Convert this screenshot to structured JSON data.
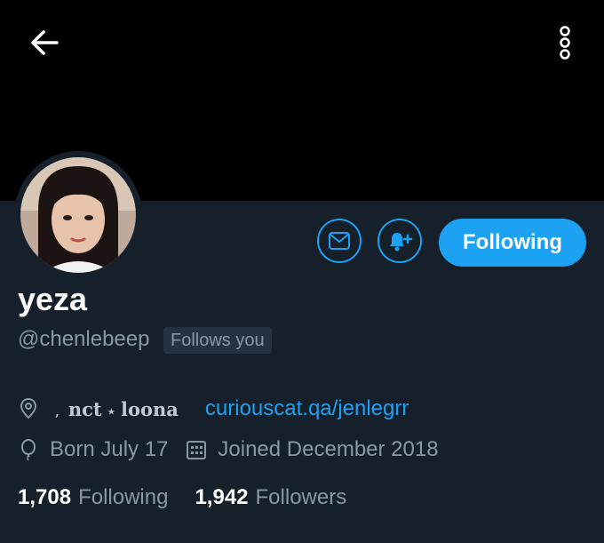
{
  "header": {
    "back_icon": "arrow-left-icon",
    "more_icon": "more-vertical-icon"
  },
  "profile": {
    "display_name": "yeza",
    "handle": "@chenlebeep",
    "follows_you_badge": "Follows you",
    "avatar_icon": "profile-avatar"
  },
  "actions": {
    "message_icon": "envelope-icon",
    "notify_icon": "bell-plus-icon",
    "following_label": "Following"
  },
  "details": {
    "location_part1": "nct",
    "location_separator": "⋆",
    "location_part2": "loona",
    "location_prefix": "‚",
    "website": "curiouscat.qa/jenlegrr",
    "birthday": "Born July 17",
    "joined": "Joined December 2018"
  },
  "stats": {
    "following_count": "1,708",
    "following_label": "Following",
    "followers_count": "1,942",
    "followers_label": "Followers"
  },
  "colors": {
    "background": "#15202b",
    "banner": "#000000",
    "accent": "#1da1f2",
    "secondary_text": "#8899a6"
  }
}
